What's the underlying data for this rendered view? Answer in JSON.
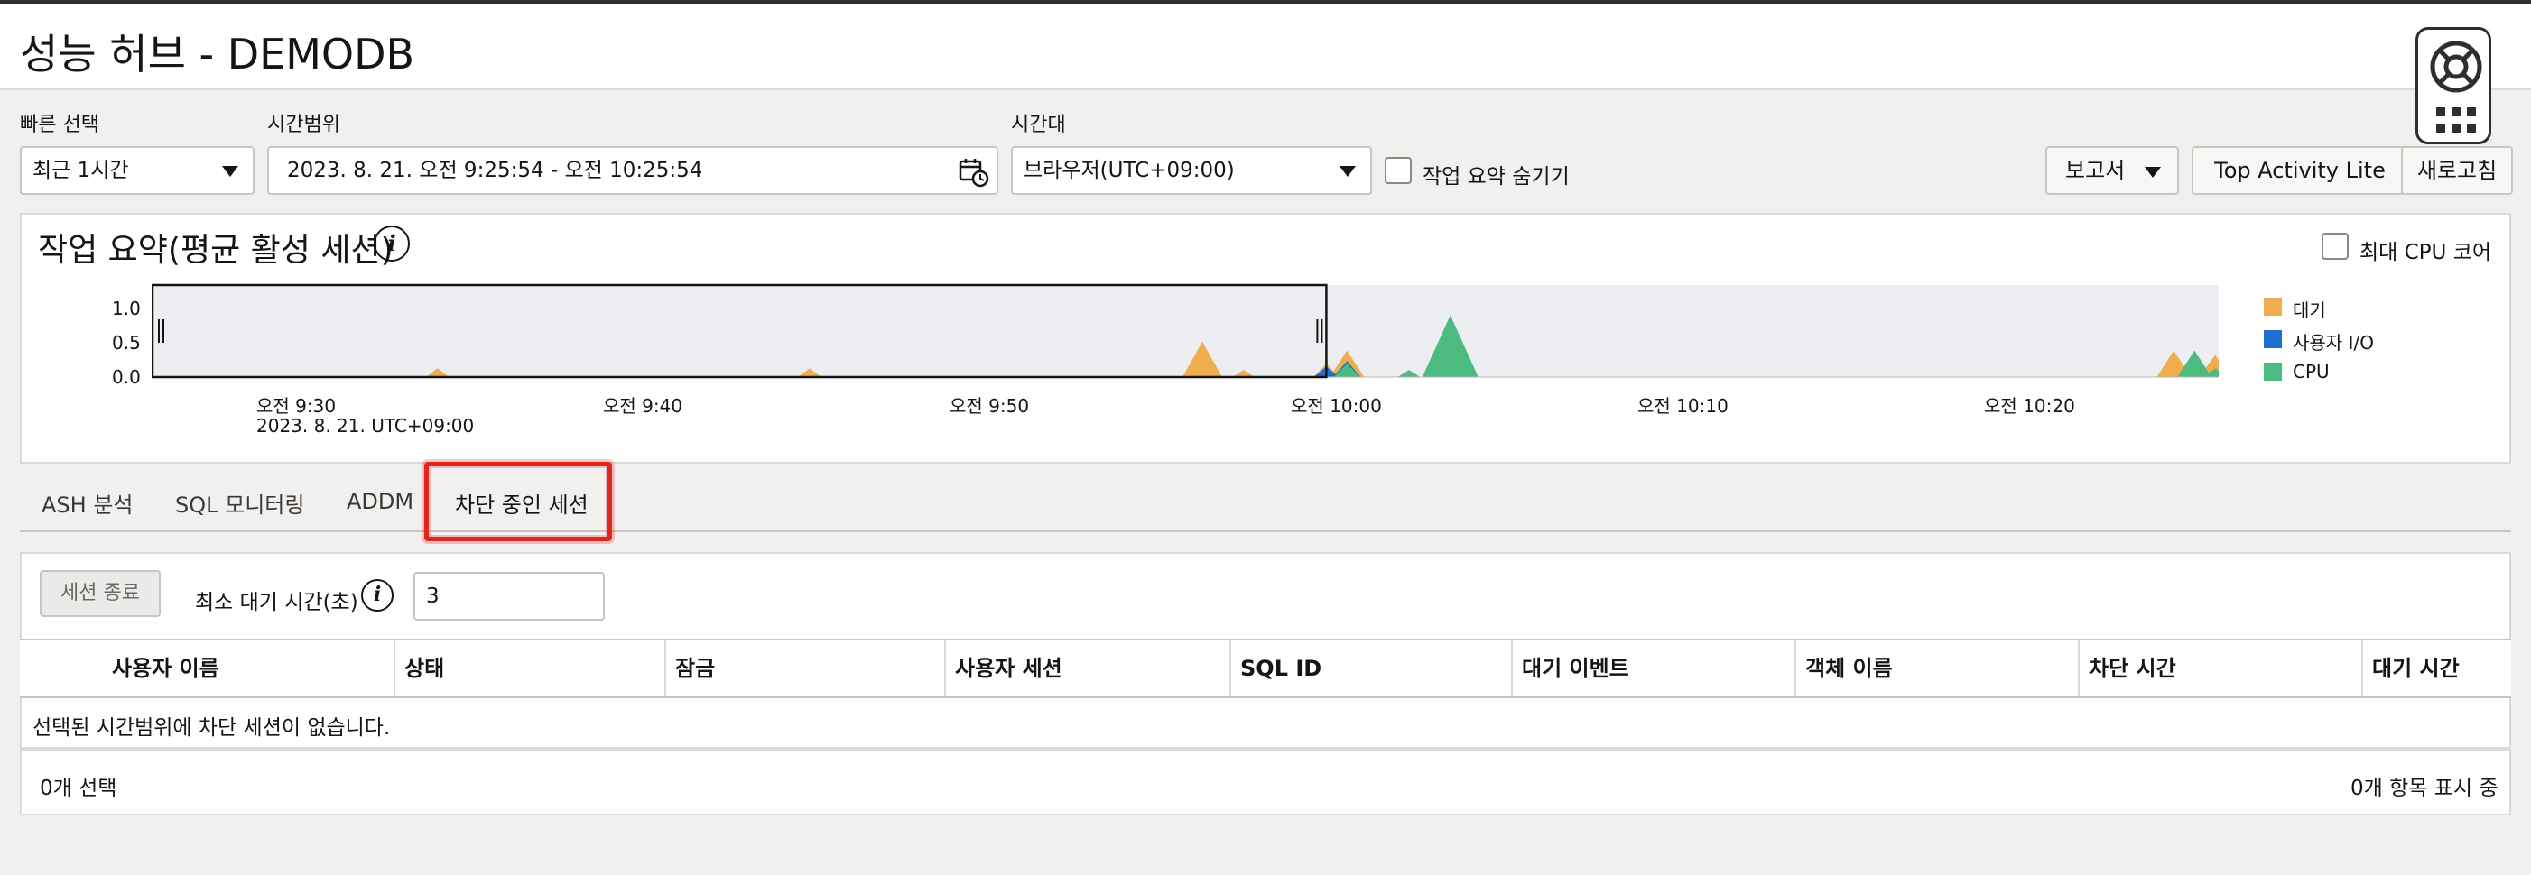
{
  "page": {
    "title": "성능 허브 - DEMODB"
  },
  "controls": {
    "quick_select_label": "빠른 선택",
    "quick_select_value": "최근 1시간",
    "time_range_label": "시간범위",
    "time_range_value": "2023. 8. 21. 오전 9:25:54 - 오전 10:25:54",
    "timezone_label": "시간대",
    "timezone_value": "브라우저(UTC+09:00)",
    "hide_summary_label": "작업 요약 숨기기",
    "report_button": "보고서",
    "top_activity_button": "Top Activity Lite",
    "refresh_button": "새로고침"
  },
  "summary": {
    "title": "작업 요약(평균 활성 세션)",
    "max_cpu_label": "최대 CPU 코어",
    "date_label": "2023. 8. 21. UTC+09:00"
  },
  "chart_data": {
    "type": "area",
    "ylim": [
      0,
      1.0
    ],
    "y_ticks": [
      "1.0",
      "0.5",
      "0.0"
    ],
    "x_ticks": [
      "오전 9:30",
      "오전 9:40",
      "오전 9:50",
      "오전 10:00",
      "오전 10:10",
      "오전 10:20"
    ],
    "legend": [
      {
        "name": "대기",
        "color": "#f0ad4e"
      },
      {
        "name": "사용자 I/O",
        "color": "#1f6fd1"
      },
      {
        "name": "CPU",
        "color": "#4cbb7f"
      }
    ],
    "selection": {
      "from": "오전 9:25:54",
      "to": "오전 10:00"
    },
    "series": [
      {
        "name": "대기",
        "points": [
          [
            9.57,
            0.1
          ],
          [
            9.75,
            0.1
          ],
          [
            9.94,
            0.4
          ],
          [
            9.96,
            0.08
          ],
          [
            10.0,
            0.15
          ],
          [
            10.01,
            0.3
          ],
          [
            10.41,
            0.3
          ],
          [
            10.43,
            0.25
          ]
        ]
      },
      {
        "name": "사용자 I/O",
        "points": [
          [
            10.0,
            0.12
          ],
          [
            10.01,
            0.18
          ]
        ]
      },
      {
        "name": "CPU",
        "points": [
          [
            10.01,
            0.15
          ],
          [
            10.04,
            0.08
          ],
          [
            10.06,
            0.7
          ],
          [
            10.42,
            0.3
          ],
          [
            10.43,
            0.1
          ]
        ]
      }
    ]
  },
  "tabs": [
    "ASH 분석",
    "SQL 모니터링",
    "ADDM",
    "차단 중인 세션"
  ],
  "blocking": {
    "end_session_button": "세션 종료",
    "min_wait_label": "최소 대기 시간(초)",
    "min_wait_value": "3",
    "columns": [
      "사용자 이름",
      "상태",
      "잠금",
      "사용자 세션",
      "SQL ID",
      "대기 이벤트",
      "객체 이름",
      "차단 시간",
      "대기 시간"
    ],
    "empty_message": "선택된 시간범위에 차단 세션이 없습니다.",
    "selected_count": "0개 선택",
    "shown_count": "0개 항목 표시 중"
  }
}
